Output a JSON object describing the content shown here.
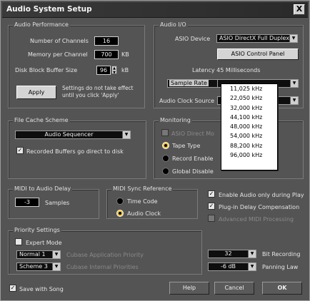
{
  "window": {
    "title": "Audio System Setup",
    "close_symbol": "X"
  },
  "audio_performance": {
    "group_label": "Audio Performance",
    "channels_label": "Number of Channels",
    "channels_value": "16",
    "memory_label": "Memory per Channel",
    "memory_value": "700",
    "memory_unit": "KB",
    "disk_label": "Disk Block Buffer Size",
    "disk_value": "96",
    "disk_unit": "kB",
    "apply_label": "Apply",
    "apply_note_1": "Settings do not take effect",
    "apply_note_2": "until you click 'Apply'"
  },
  "audio_io": {
    "group_label": "Audio I/O",
    "asio_label": "ASIO Device",
    "asio_value": "ASIO DirectX Full Duplex",
    "asio_control_label": "ASIO Control Panel",
    "latency_text": "Latency 45 Milliseconds",
    "sample_rate_label": "Sample Rate",
    "clock_label": "Audio Clock Source",
    "sample_rate_options": [
      "11,025 kHz",
      "22,050 kHz",
      "32,000 kHz",
      "44,100 kHz",
      "48,000 kHz",
      "54,000 kHz",
      "88,200 kHz",
      "96,000 kHz"
    ]
  },
  "file_cache": {
    "group_label": "File Cache Scheme",
    "scheme_value": "Audio Sequencer",
    "recorded_label": "Recorded Buffers go direct to disk"
  },
  "monitoring": {
    "group_label": "Monitoring",
    "asio_direct_label": "ASIO Direct Mo",
    "tape_label": "Tape Type",
    "record_label": "Record Enable",
    "global_label": "Global Disable"
  },
  "midi_delay": {
    "group_label": "MIDI to Audio Delay",
    "value": "-3",
    "unit": "Samples"
  },
  "midi_sync": {
    "group_label": "MIDI Sync Reference",
    "time_code": "Time Code",
    "audio_clock": "Audio Clock"
  },
  "options": {
    "enable_audio": "Enable Audio only during Play",
    "plugin_delay": "Plug-in Delay Compensation",
    "advanced_midi": "Advanced MIDI Processing"
  },
  "priority": {
    "group_label": "Priority Settings",
    "expert_label": "Expert Mode",
    "app_value": "Normal 1",
    "app_label": "Cubase Application Priority",
    "internal_value": "Scheme 3",
    "internal_label": "Cubase Internal Priorities"
  },
  "recording": {
    "bit_value": "32",
    "bit_label": "Bit Recording",
    "pan_value": "-6 dB",
    "pan_label": "Panning Law"
  },
  "footer": {
    "save_song": "Save with Song",
    "help": "Help",
    "cancel": "Cancel",
    "ok": "OK"
  }
}
